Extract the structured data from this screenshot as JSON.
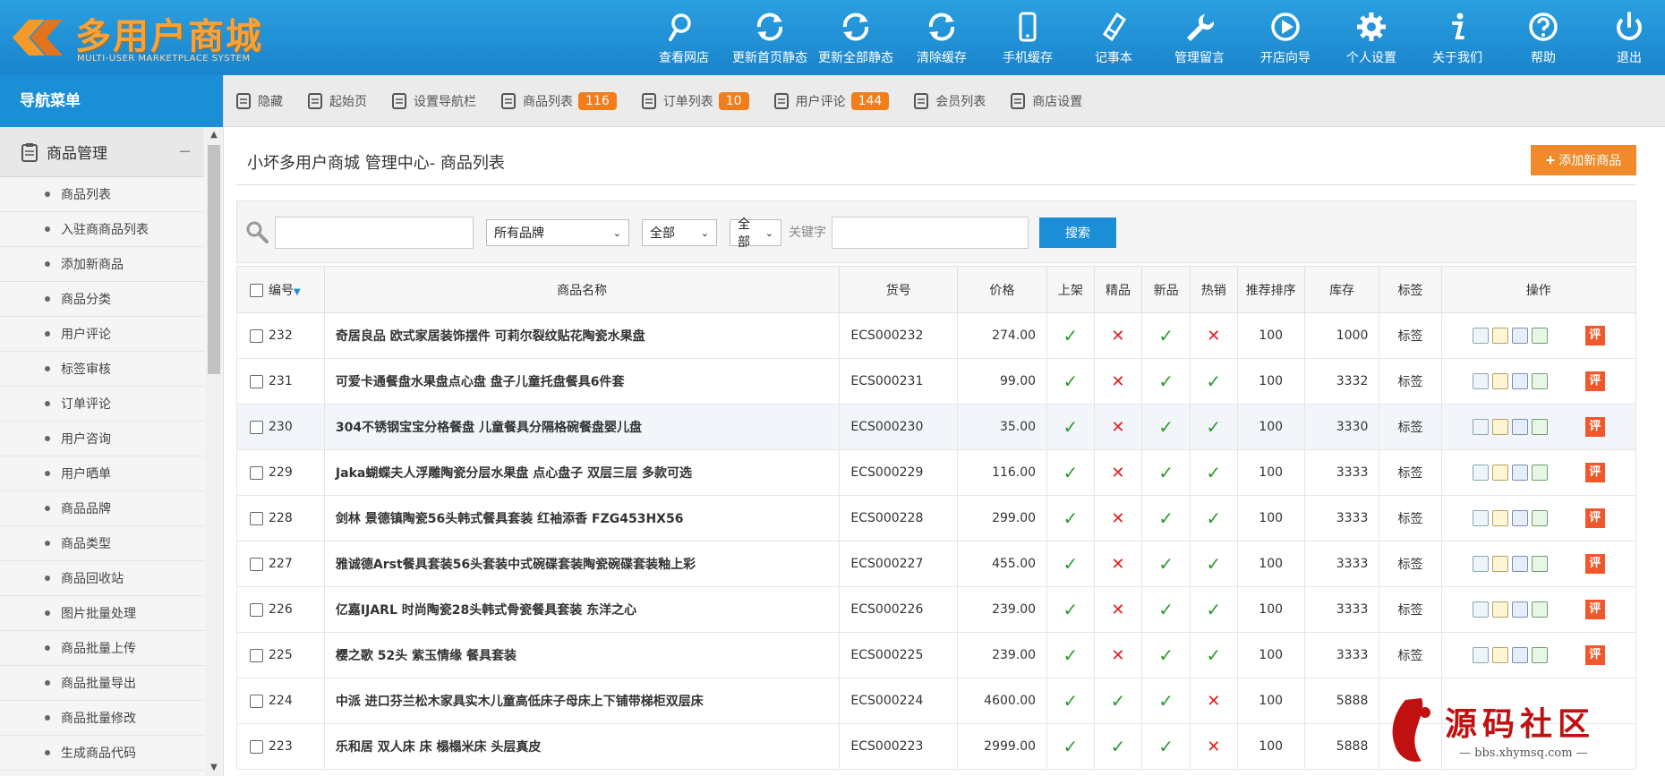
{
  "header": {
    "logo_title": "多用户商城",
    "logo_subtitle": "MULTI-USER MARKETPLACE SYSTEM",
    "nav": [
      {
        "label": "查看网店",
        "icon": "search-icon"
      },
      {
        "label": "更新首页静态",
        "icon": "refresh-icon"
      },
      {
        "label": "更新全部静态",
        "icon": "refresh-icon"
      },
      {
        "label": "清除缓存",
        "icon": "refresh-icon"
      },
      {
        "label": "手机缓存",
        "icon": "mobile-icon"
      },
      {
        "label": "记事本",
        "icon": "notepad-icon"
      },
      {
        "label": "管理留言",
        "icon": "wrench-icon"
      },
      {
        "label": "开店向导",
        "icon": "play-icon"
      },
      {
        "label": "个人设置",
        "icon": "gear-icon"
      },
      {
        "label": "关于我们",
        "icon": "info-icon"
      },
      {
        "label": "帮助",
        "icon": "help-icon"
      },
      {
        "label": "退出",
        "icon": "power-icon"
      }
    ]
  },
  "sidebar": {
    "title": "导航菜单",
    "group_label": "商品管理",
    "group_toggle": "−",
    "items": [
      "商品列表",
      "入驻商商品列表",
      "添加新商品",
      "商品分类",
      "用户评论",
      "标签审核",
      "订单评论",
      "用户咨询",
      "用户晒单",
      "商品品牌",
      "商品类型",
      "商品回收站",
      "图片批量处理",
      "商品批量上传",
      "商品批量导出",
      "商品批量修改",
      "生成商品代码"
    ]
  },
  "subbar": {
    "items": [
      {
        "label": "隐藏",
        "icon": "hide-icon",
        "badge": ""
      },
      {
        "label": "起始页",
        "icon": "start-page-icon",
        "badge": ""
      },
      {
        "label": "设置导航栏",
        "icon": "settings-nav-icon",
        "badge": ""
      },
      {
        "label": "商品列表",
        "icon": "goods-list-icon",
        "badge": "116"
      },
      {
        "label": "订单列表",
        "icon": "order-list-icon",
        "badge": "10"
      },
      {
        "label": "用户评论",
        "icon": "comments-icon",
        "badge": "144"
      },
      {
        "label": "会员列表",
        "icon": "members-icon",
        "badge": ""
      },
      {
        "label": "商店设置",
        "icon": "shop-settings-icon",
        "badge": ""
      }
    ]
  },
  "main": {
    "title": "小坏多用户商城 管理中心- 商品列表",
    "add_button": "添加新商品",
    "search": {
      "brand_selected": "所有品牌",
      "filter1_selected": "全部",
      "filter2_selected": "全部",
      "keyword_label": "关键字",
      "search_button": "搜索"
    }
  },
  "table": {
    "headers": [
      "编号",
      "商品名称",
      "货号",
      "价格",
      "上架",
      "精品",
      "新品",
      "热销",
      "推荐排序",
      "库存",
      "标签",
      "操作"
    ],
    "rows": [
      {
        "id": "232",
        "name": "奇居良品 欧式家居装饰摆件 可莉尔裂纹贴花陶瓷水果盘",
        "sn": "ECS000232",
        "price": "274.00",
        "onsale": true,
        "best": false,
        "new": true,
        "hot": false,
        "sort": "100",
        "stock": "1000",
        "tag": "标签"
      },
      {
        "id": "231",
        "name": "可爱卡通餐盘水果盘点心盘 盘子儿童托盘餐具6件套",
        "sn": "ECS000231",
        "price": "99.00",
        "onsale": true,
        "best": false,
        "new": true,
        "hot": true,
        "sort": "100",
        "stock": "3332",
        "tag": "标签"
      },
      {
        "id": "230",
        "name": "304不锈钢宝宝分格餐盘 儿童餐具分隔格碗餐盘婴儿盘",
        "sn": "ECS000230",
        "price": "35.00",
        "onsale": true,
        "best": false,
        "new": true,
        "hot": true,
        "sort": "100",
        "stock": "3330",
        "tag": "标签"
      },
      {
        "id": "229",
        "name": "Jaka蝴蝶夫人浮雕陶瓷分层水果盘 点心盘子 双层三层 多款可选",
        "sn": "ECS000229",
        "price": "116.00",
        "onsale": true,
        "best": false,
        "new": true,
        "hot": true,
        "sort": "100",
        "stock": "3333",
        "tag": "标签"
      },
      {
        "id": "228",
        "name": "剑林 景德镇陶瓷56头韩式餐具套装 红袖添香 FZG453HX56",
        "sn": "ECS000228",
        "price": "299.00",
        "onsale": true,
        "best": false,
        "new": true,
        "hot": true,
        "sort": "100",
        "stock": "3333",
        "tag": "标签"
      },
      {
        "id": "227",
        "name": "雅诚德Arst餐具套装56头套装中式碗碟套装陶瓷碗碟套装釉上彩",
        "sn": "ECS000227",
        "price": "455.00",
        "onsale": true,
        "best": false,
        "new": true,
        "hot": true,
        "sort": "100",
        "stock": "3333",
        "tag": "标签"
      },
      {
        "id": "226",
        "name": "亿嘉IJARL 时尚陶瓷28头韩式骨瓷餐具套装 东洋之心",
        "sn": "ECS000226",
        "price": "239.00",
        "onsale": true,
        "best": false,
        "new": true,
        "hot": true,
        "sort": "100",
        "stock": "3333",
        "tag": "标签"
      },
      {
        "id": "225",
        "name": "樱之歌 52头 紫玉情缘 餐具套装",
        "sn": "ECS000225",
        "price": "239.00",
        "onsale": true,
        "best": false,
        "new": true,
        "hot": true,
        "sort": "100",
        "stock": "3333",
        "tag": "标签"
      },
      {
        "id": "224",
        "name": "中派 进口芬兰松木家具实木儿童高低床子母床上下铺带梯柜双层床",
        "sn": "ECS000224",
        "price": "4600.00",
        "onsale": true,
        "best": true,
        "new": true,
        "hot": false,
        "sort": "100",
        "stock": "5888",
        "tag": ""
      },
      {
        "id": "223",
        "name": "乐和居 双人床 床 榻榻米床 头层真皮",
        "sn": "ECS000223",
        "price": "2999.00",
        "onsale": true,
        "best": true,
        "new": true,
        "hot": false,
        "sort": "100",
        "stock": "5888",
        "tag": ""
      }
    ],
    "review_label": "评"
  },
  "watermark": {
    "title": "源码社区",
    "url": "bbs.xhymsq.com"
  },
  "colors": {
    "header": "#1a8fd8",
    "accent": "#f17e1b",
    "ok": "#2e9a2e",
    "no": "#e02020"
  }
}
